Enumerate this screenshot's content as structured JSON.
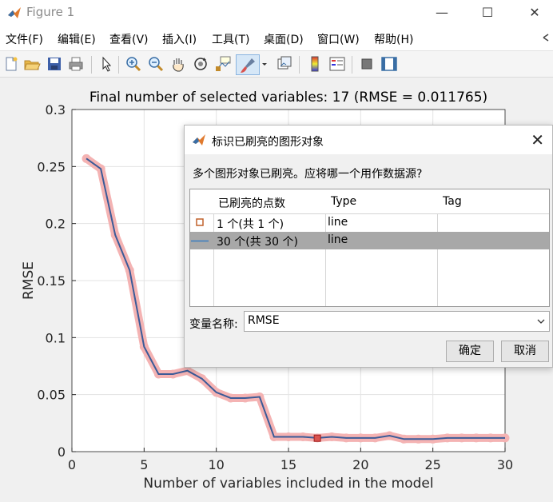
{
  "window": {
    "title": "Figure 1"
  },
  "menu": [
    "文件(F)",
    "编辑(E)",
    "查看(V)",
    "插入(I)",
    "工具(T)",
    "桌面(D)",
    "窗口(W)",
    "帮助(H)"
  ],
  "toolbar": {
    "icons": [
      "new-file-icon",
      "open-folder-icon",
      "save-icon",
      "print-icon",
      "pointer-icon",
      "zoom-in-icon",
      "zoom-out-icon",
      "pan-hand-icon",
      "rotate-3d-icon",
      "data-cursor-icon",
      "brush-icon",
      "link-plot-icon",
      "colorbar-icon",
      "legend-icon",
      "hide-plot-tools-icon",
      "show-plot-tools-icon"
    ],
    "active": "brush-icon"
  },
  "chart_data": {
    "type": "line",
    "title": "Final number of selected variables: 17  (RMSE = 0.011765)",
    "xlabel": "Number of variables included in the model",
    "ylabel": "RMSE",
    "xlim": [
      0,
      30
    ],
    "ylim": [
      0,
      0.3
    ],
    "xticks": [
      0,
      5,
      10,
      15,
      20,
      25,
      30
    ],
    "yticks": [
      0,
      0.05,
      0.1,
      0.15,
      0.2,
      0.25,
      0.3
    ],
    "ytick_labels": [
      "0",
      "0.05",
      "0.1",
      "0.15",
      "0.2",
      "0.25",
      "0.3"
    ],
    "grid": true,
    "series": [
      {
        "x": [
          1,
          2,
          3,
          4,
          5,
          6,
          7,
          8,
          9,
          10,
          11,
          12,
          13,
          14,
          15,
          16,
          17,
          18,
          19,
          20,
          21,
          22,
          23,
          24,
          25,
          26,
          27,
          28,
          29,
          30
        ],
        "values": [
          0.257,
          0.248,
          0.19,
          0.159,
          0.092,
          0.068,
          0.068,
          0.071,
          0.064,
          0.052,
          0.047,
          0.047,
          0.048,
          0.013,
          0.013,
          0.013,
          0.012,
          0.013,
          0.012,
          0.012,
          0.012,
          0.014,
          0.011,
          0.011,
          0.011,
          0.012,
          0.012,
          0.012,
          0.012,
          0.012
        ],
        "color": "#3b5b98",
        "brushed": true,
        "brush_color": "#f4b3b3"
      },
      {
        "x": [
          17
        ],
        "values": [
          0.011765
        ],
        "marker": "square",
        "color": "#d9534f"
      }
    ]
  },
  "dialog": {
    "title": "标识已刷亮的图形对象",
    "question": "多个图形对象已刷亮。应将哪一个用作数据源?",
    "columns": [
      "已刷亮的点数",
      "Type",
      "Tag"
    ],
    "rows": [
      {
        "marker": "square-marker-icon",
        "points": "1 个(共 1 个)",
        "type": "line",
        "tag": ""
      },
      {
        "marker": "line-marker-icon",
        "points": "30 个(共 30 个)",
        "type": "line",
        "tag": ""
      }
    ],
    "selected_row": 1,
    "variable_label": "变量名称:",
    "variable_value": "RMSE",
    "ok_label": "确定",
    "cancel_label": "取消"
  }
}
